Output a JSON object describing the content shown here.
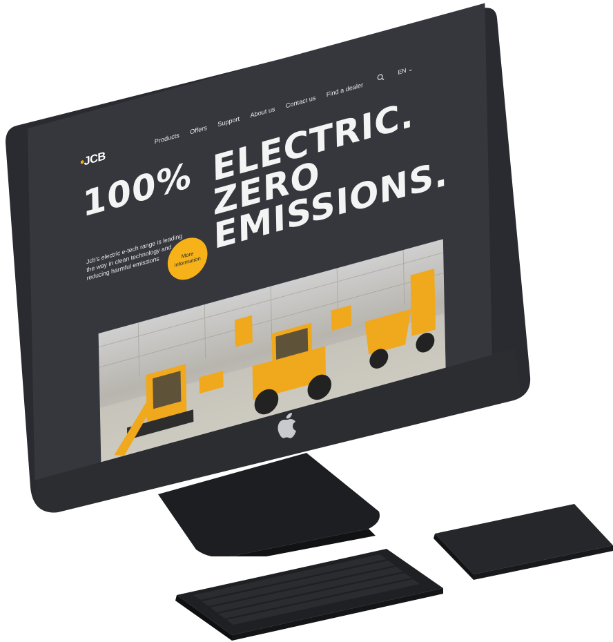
{
  "site": {
    "logo": "JCB",
    "nav": [
      "Products",
      "Offers",
      "Support",
      "About us",
      "Contact us",
      "Find a dealer"
    ],
    "language": "EN",
    "headline": {
      "line1_left": "100%",
      "line1_right": "ELECTRIC.",
      "line2": "ZERO",
      "line3": "EMISSIONS."
    },
    "description": "Jcb's electric e-tech range is leading the way in clean technology and reducing harmful emissions",
    "cta_label": "More information"
  },
  "colors": {
    "accent": "#f7b21a",
    "page_bg": "#35373d",
    "device": "#26272b"
  },
  "icons": {
    "search": "search-icon",
    "language_dropdown": "chevron-down-icon",
    "brand": "apple-logo-icon"
  }
}
